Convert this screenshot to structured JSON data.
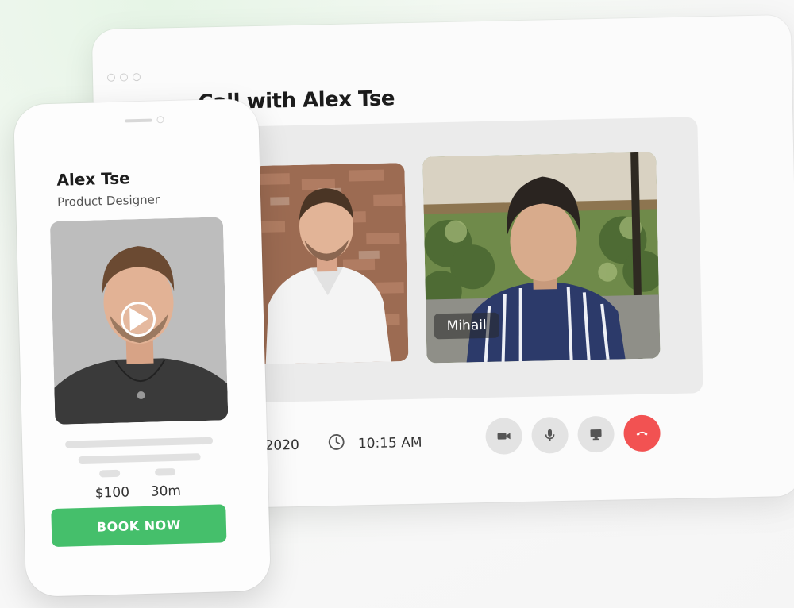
{
  "call_window": {
    "title": "Call with Alex Tse",
    "date_partial": ", 2020",
    "time": "10:15 AM",
    "participant_name": "Mihail",
    "controls": [
      "video-camera-icon",
      "microphone-icon",
      "screen-share-icon",
      "end-call-icon"
    ]
  },
  "profile_card": {
    "name": "Alex Tse",
    "role": "Product Designer",
    "price": "$100",
    "duration": "30m",
    "book_label": "BOOK NOW"
  },
  "colors": {
    "accent_green": "#45bf6b",
    "end_call_red": "#f25252",
    "control_gray": "#e3e3e3"
  }
}
